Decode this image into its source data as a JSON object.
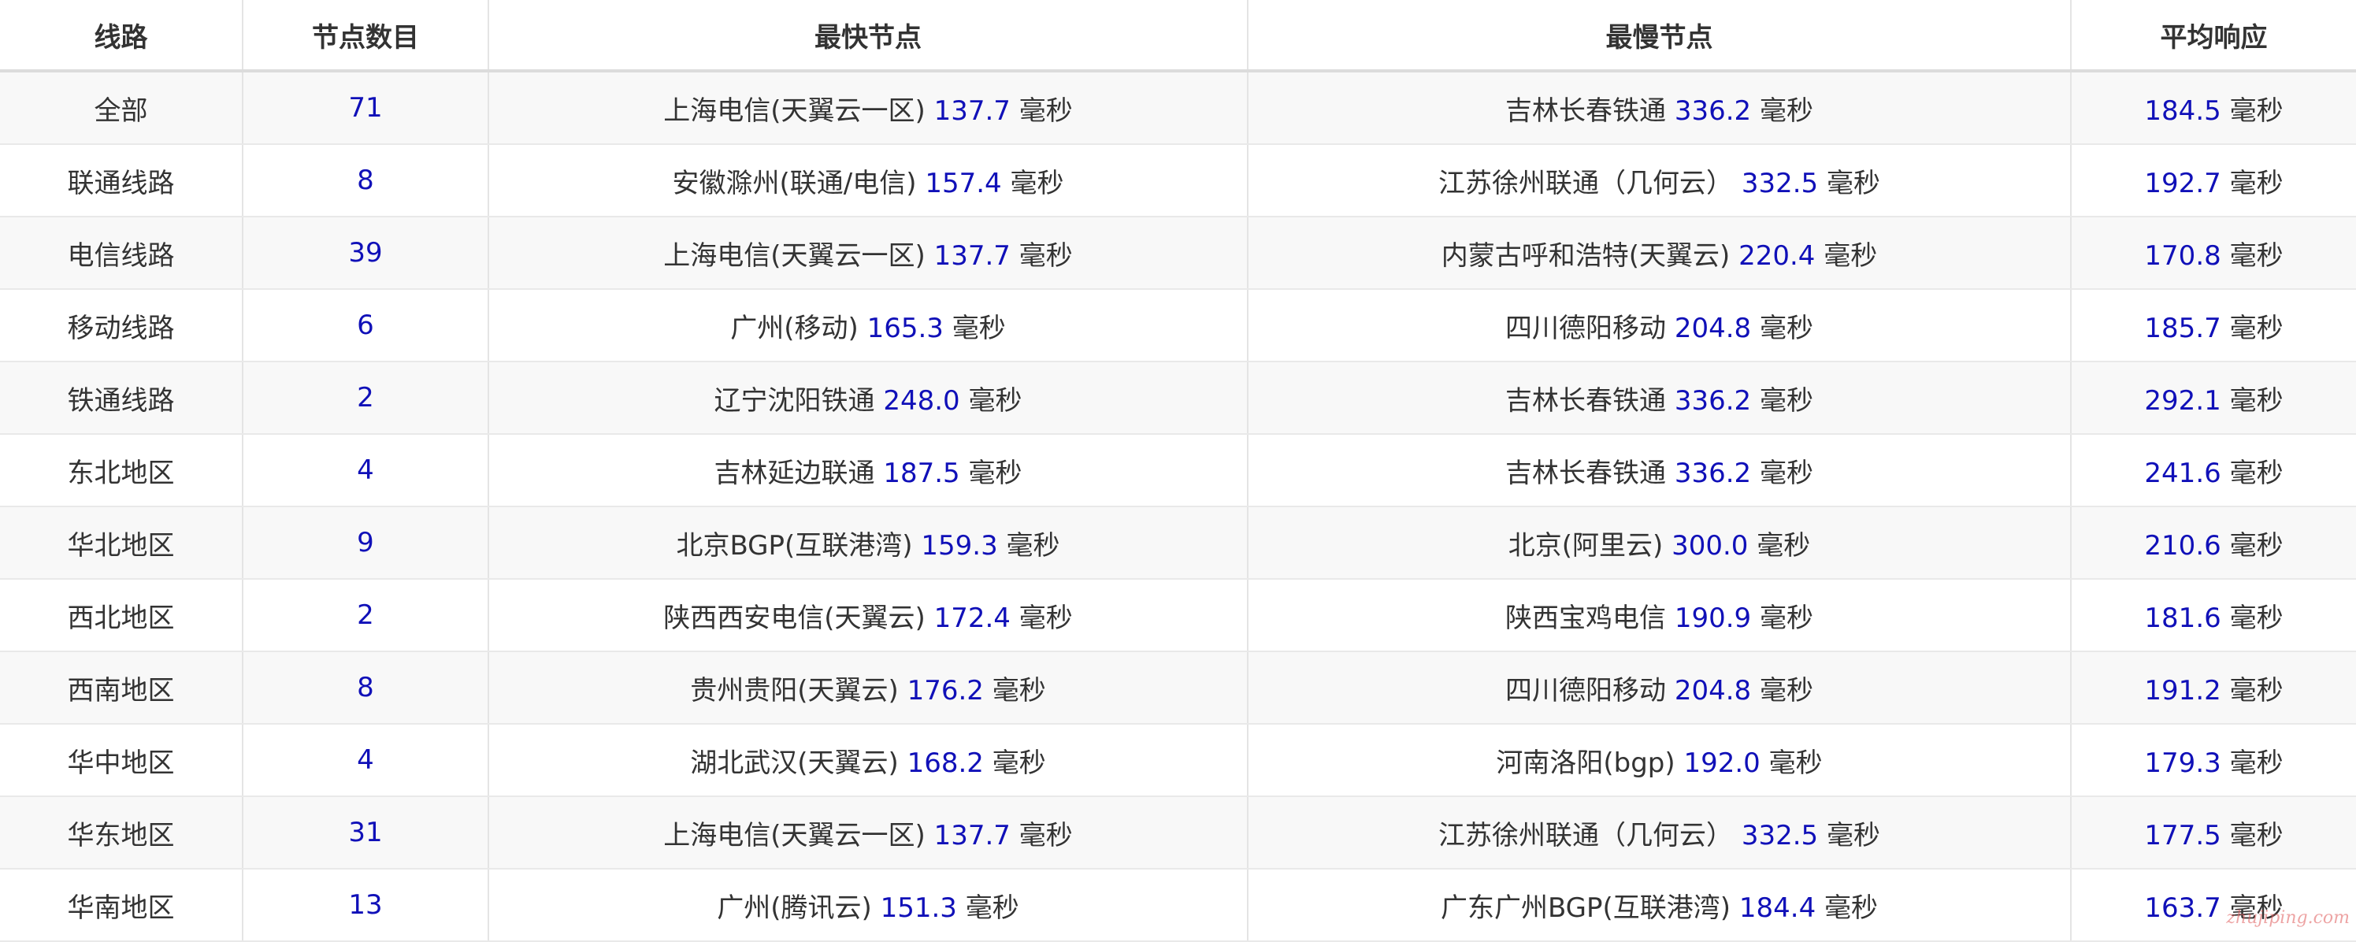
{
  "table": {
    "headers": [
      "线路",
      "节点数目",
      "最快节点",
      "最慢节点",
      "平均响应"
    ],
    "unit": "毫秒",
    "rows": [
      {
        "line": "全部",
        "count": "71",
        "fastest_node": "上海电信(天翼云一区)",
        "fastest_ms": "137.7",
        "slowest_node": "吉林长春铁通",
        "slowest_ms": "336.2",
        "avg_ms": "184.5"
      },
      {
        "line": "联通线路",
        "count": "8",
        "fastest_node": "安徽滁州(联通/电信)",
        "fastest_ms": "157.4",
        "slowest_node": "江苏徐州联通（几何云）",
        "slowest_ms": "332.5",
        "avg_ms": "192.7"
      },
      {
        "line": "电信线路",
        "count": "39",
        "fastest_node": "上海电信(天翼云一区)",
        "fastest_ms": "137.7",
        "slowest_node": "内蒙古呼和浩特(天翼云)",
        "slowest_ms": "220.4",
        "avg_ms": "170.8"
      },
      {
        "line": "移动线路",
        "count": "6",
        "fastest_node": "广州(移动)",
        "fastest_ms": "165.3",
        "slowest_node": "四川德阳移动",
        "slowest_ms": "204.8",
        "avg_ms": "185.7"
      },
      {
        "line": "铁通线路",
        "count": "2",
        "fastest_node": "辽宁沈阳铁通",
        "fastest_ms": "248.0",
        "slowest_node": "吉林长春铁通",
        "slowest_ms": "336.2",
        "avg_ms": "292.1"
      },
      {
        "line": "东北地区",
        "count": "4",
        "fastest_node": "吉林延边联通",
        "fastest_ms": "187.5",
        "slowest_node": "吉林长春铁通",
        "slowest_ms": "336.2",
        "avg_ms": "241.6"
      },
      {
        "line": "华北地区",
        "count": "9",
        "fastest_node": "北京BGP(互联港湾)",
        "fastest_ms": "159.3",
        "slowest_node": "北京(阿里云)",
        "slowest_ms": "300.0",
        "avg_ms": "210.6"
      },
      {
        "line": "西北地区",
        "count": "2",
        "fastest_node": "陕西西安电信(天翼云)",
        "fastest_ms": "172.4",
        "slowest_node": "陕西宝鸡电信",
        "slowest_ms": "190.9",
        "avg_ms": "181.6"
      },
      {
        "line": "西南地区",
        "count": "8",
        "fastest_node": "贵州贵阳(天翼云)",
        "fastest_ms": "176.2",
        "slowest_node": "四川德阳移动",
        "slowest_ms": "204.8",
        "avg_ms": "191.2"
      },
      {
        "line": "华中地区",
        "count": "4",
        "fastest_node": "湖北武汉(天翼云)",
        "fastest_ms": "168.2",
        "slowest_node": "河南洛阳(bgp)",
        "slowest_ms": "192.0",
        "avg_ms": "179.3"
      },
      {
        "line": "华东地区",
        "count": "31",
        "fastest_node": "上海电信(天翼云一区)",
        "fastest_ms": "137.7",
        "slowest_node": "江苏徐州联通（几何云）",
        "slowest_ms": "332.5",
        "avg_ms": "177.5"
      },
      {
        "line": "华南地区",
        "count": "13",
        "fastest_node": "广州(腾讯云)",
        "fastest_ms": "151.3",
        "slowest_node": "广东广州BGP(互联港湾)",
        "slowest_ms": "184.4",
        "avg_ms": "163.7"
      }
    ]
  },
  "watermark": "zhujiping.com",
  "colors": {
    "number": "#1010b8",
    "text": "#333333",
    "stripe": "#f8f8f8",
    "border": "#e4e4e4",
    "watermark": "#e05a5a"
  }
}
